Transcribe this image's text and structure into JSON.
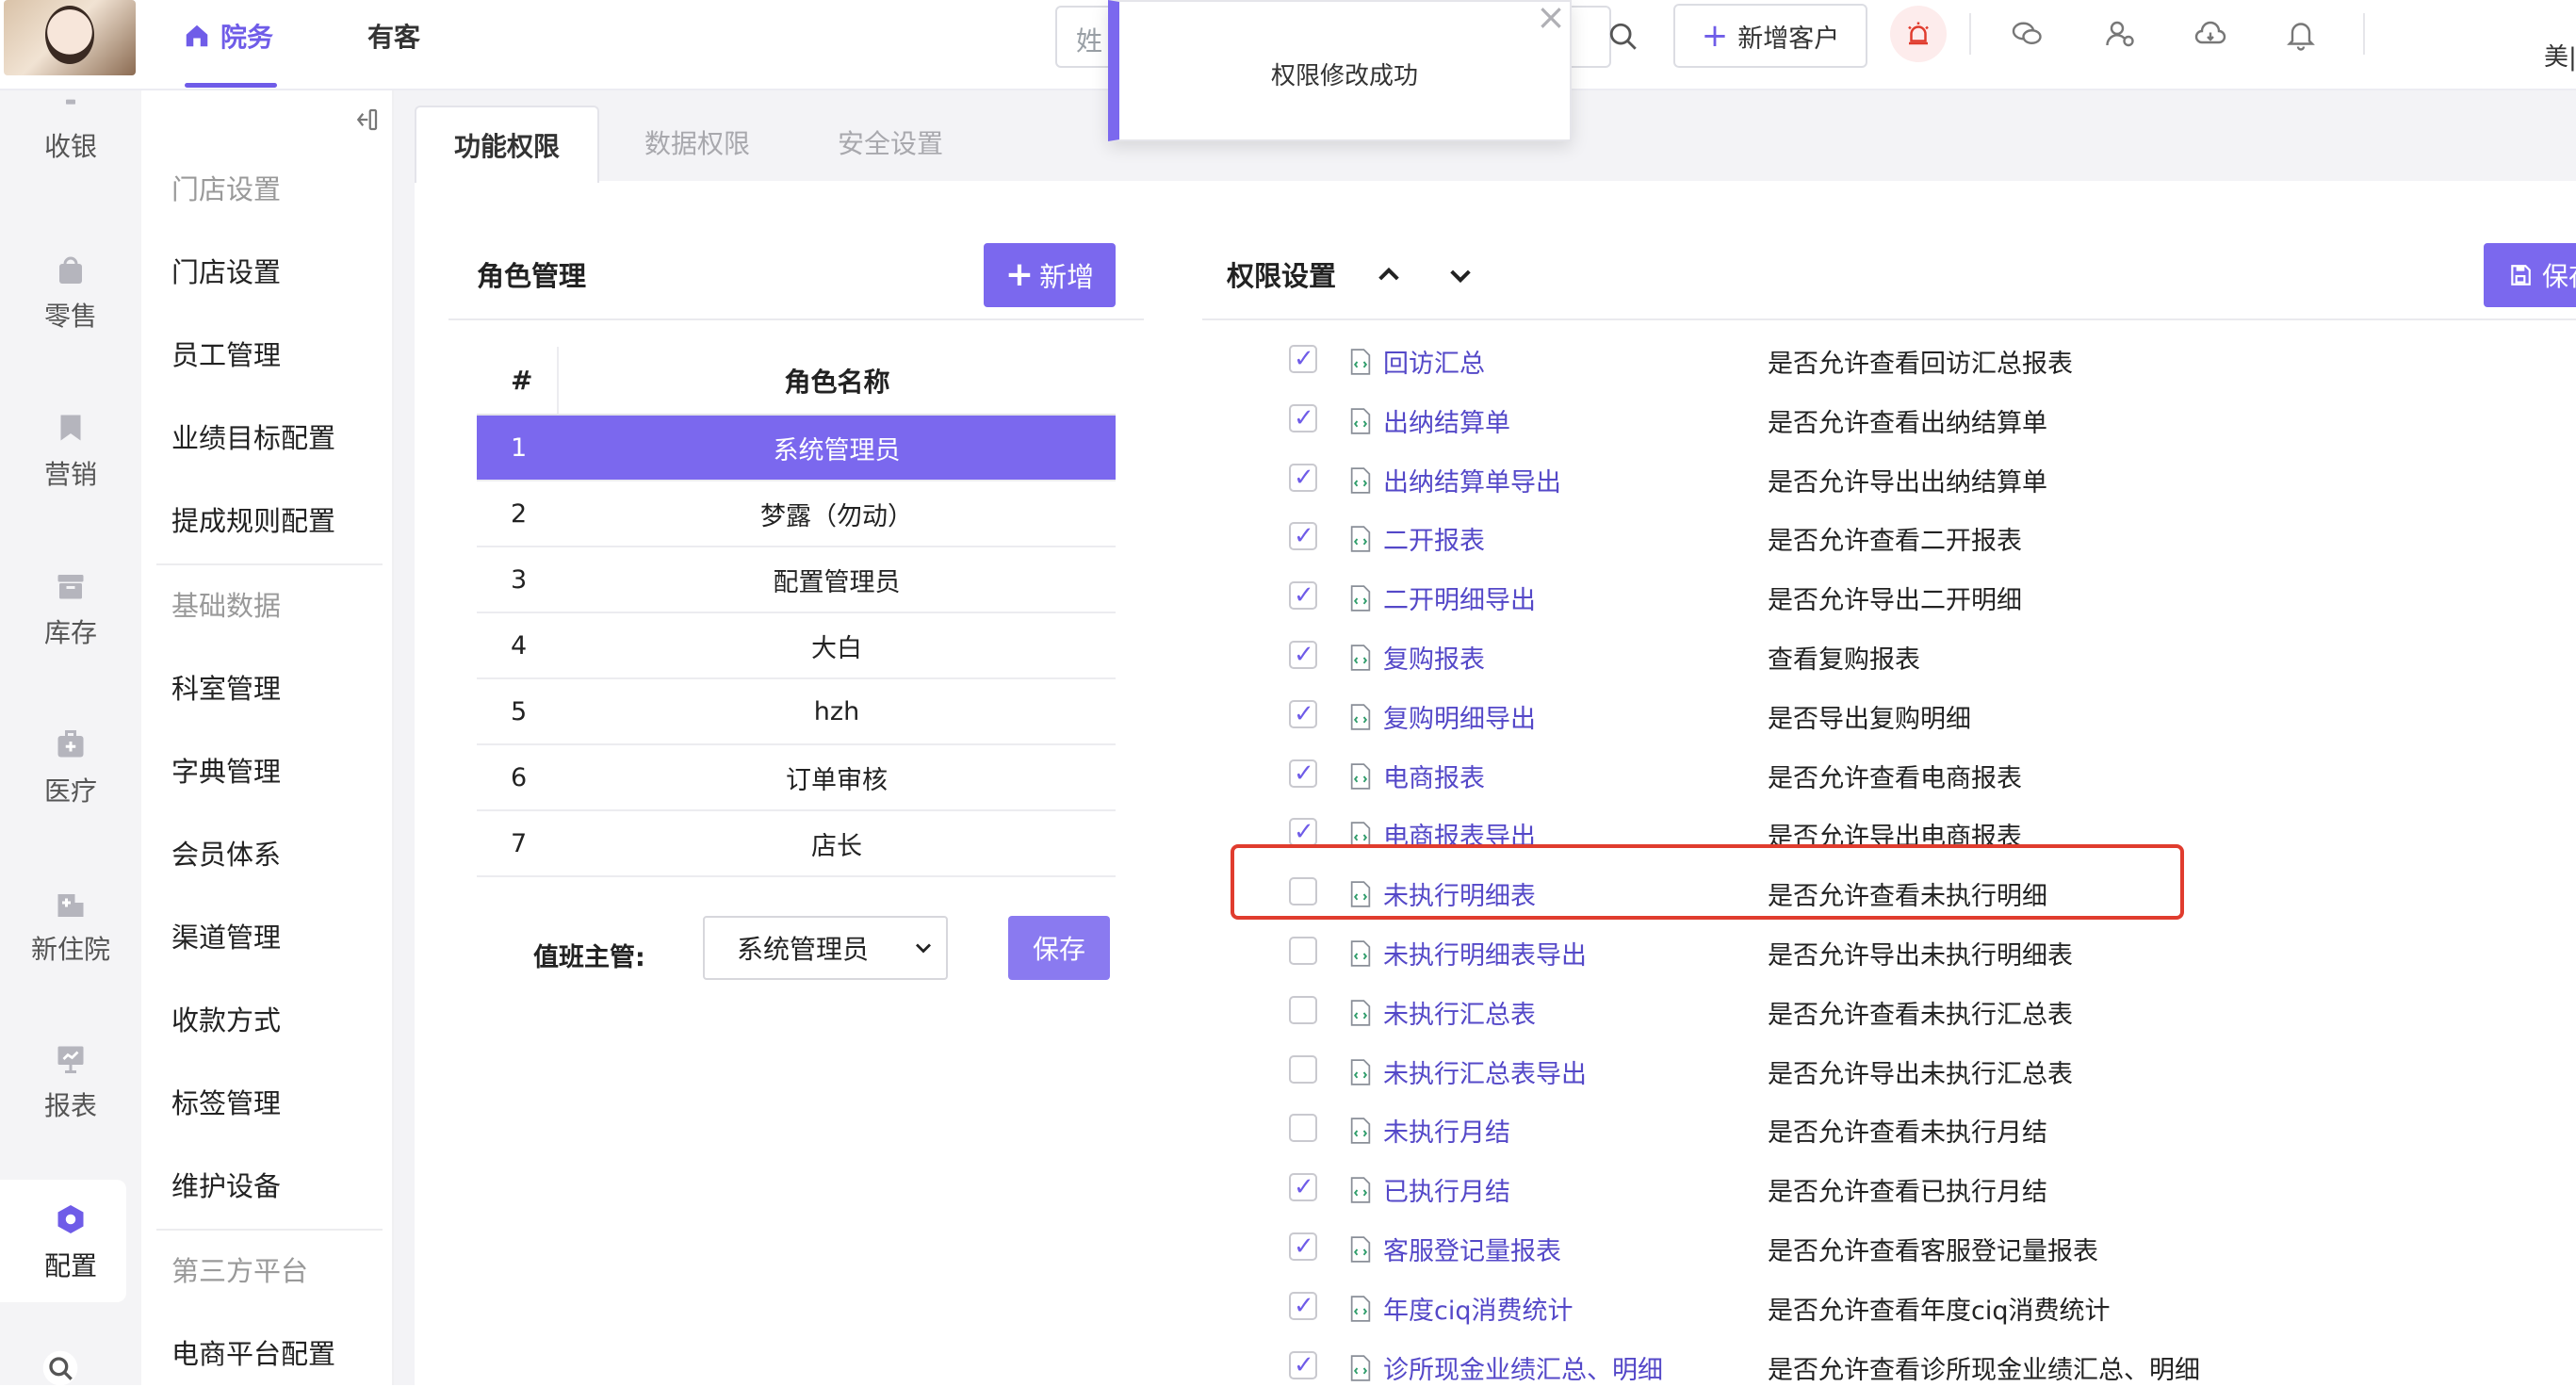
{
  "topbar": {
    "nav": [
      {
        "label": "院务",
        "active": true,
        "icon": "home-icon"
      },
      {
        "label": "有客",
        "active": false
      }
    ],
    "search_placeholder": "姓",
    "add_customer_label": "新增客户",
    "user_label": "美|",
    "icons": [
      "alarm-icon",
      "wechat-icon",
      "user-settings-icon",
      "cloud-icon",
      "bell-icon"
    ]
  },
  "toast": {
    "message": "权限修改成功"
  },
  "rail": {
    "items": [
      {
        "label": "收银",
        "icon": "cashier-icon"
      },
      {
        "label": "零售",
        "icon": "bag-icon"
      },
      {
        "label": "营销",
        "icon": "bookmark-icon"
      },
      {
        "label": "库存",
        "icon": "box-icon"
      },
      {
        "label": "医疗",
        "icon": "medical-kit-icon"
      },
      {
        "label": "新住院",
        "icon": "hospital-icon"
      },
      {
        "label": "报表",
        "icon": "report-board-icon"
      },
      {
        "label": "配置",
        "icon": "config-hex-icon",
        "active": true
      }
    ]
  },
  "submenu": {
    "items": [
      {
        "label": "门店设置",
        "type": "group"
      },
      {
        "label": "门店设置",
        "type": "item"
      },
      {
        "label": "员工管理",
        "type": "item"
      },
      {
        "label": "业绩目标配置",
        "type": "item"
      },
      {
        "label": "提成规则配置",
        "type": "item"
      },
      {
        "label": "基础数据",
        "type": "group"
      },
      {
        "label": "科室管理",
        "type": "item"
      },
      {
        "label": "字典管理",
        "type": "item"
      },
      {
        "label": "会员体系",
        "type": "item"
      },
      {
        "label": "渠道管理",
        "type": "item"
      },
      {
        "label": "收款方式",
        "type": "item"
      },
      {
        "label": "标签管理",
        "type": "item"
      },
      {
        "label": "维护设备",
        "type": "item"
      },
      {
        "label": "第三方平台",
        "type": "group"
      },
      {
        "label": "电商平台配置",
        "type": "item"
      }
    ]
  },
  "tabs": [
    {
      "label": "功能权限",
      "active": true
    },
    {
      "label": "数据权限",
      "active": false
    },
    {
      "label": "安全设置",
      "active": false
    }
  ],
  "roles": {
    "title": "角色管理",
    "add_label": "新增",
    "columns": [
      "#",
      "角色名称"
    ],
    "rows": [
      {
        "no": "1",
        "name": "系统管理员",
        "selected": true
      },
      {
        "no": "2",
        "name": "梦露（勿动）"
      },
      {
        "no": "3",
        "name": "配置管理员"
      },
      {
        "no": "4",
        "name": "大白"
      },
      {
        "no": "5",
        "name": "hzh"
      },
      {
        "no": "6",
        "name": "订单审核"
      },
      {
        "no": "7",
        "name": "店长"
      }
    ],
    "duty_label": "值班主管:",
    "duty_value": "系统管理员",
    "save_label": "保存"
  },
  "permissions": {
    "title": "权限设置",
    "save_label": "保存",
    "rows": [
      {
        "name": "回访汇总",
        "desc": "是否允许查看回访汇总报表",
        "checked": true
      },
      {
        "name": "出纳结算单",
        "desc": "是否允许查看出纳结算单",
        "checked": true
      },
      {
        "name": "出纳结算单导出",
        "desc": "是否允许导出出纳结算单",
        "checked": true
      },
      {
        "name": "二开报表",
        "desc": "是否允许查看二开报表",
        "checked": true
      },
      {
        "name": "二开明细导出",
        "desc": "是否允许导出二开明细",
        "checked": true
      },
      {
        "name": "复购报表",
        "desc": "查看复购报表",
        "checked": true
      },
      {
        "name": "复购明细导出",
        "desc": "是否导出复购明细",
        "checked": true
      },
      {
        "name": "电商报表",
        "desc": "是否允许查看电商报表",
        "checked": true
      },
      {
        "name": "电商报表导出",
        "desc": "是否允许导出电商报表",
        "checked": true
      },
      {
        "name": "未执行明细表",
        "desc": "是否允许查看未执行明细",
        "checked": false,
        "highlighted": true
      },
      {
        "name": "未执行明细表导出",
        "desc": "是否允许导出未执行明细表",
        "checked": false
      },
      {
        "name": "未执行汇总表",
        "desc": "是否允许查看未执行汇总表",
        "checked": false
      },
      {
        "name": "未执行汇总表导出",
        "desc": "是否允许导出未执行汇总表",
        "checked": false
      },
      {
        "name": "未执行月结",
        "desc": "是否允许查看未执行月结",
        "checked": false
      },
      {
        "name": "已执行月结",
        "desc": "是否允许查看已执行月结",
        "checked": true
      },
      {
        "name": "客服登记量报表",
        "desc": "是否允许查看客服登记量报表",
        "checked": true
      },
      {
        "name": "年度ciq消费统计",
        "desc": "是否允许查看年度ciq消费统计",
        "checked": true
      },
      {
        "name": "诊所现金业绩汇总、明细",
        "desc": "是否允许查看诊所现金业绩汇总、明细",
        "checked": true
      }
    ]
  },
  "colors": {
    "accent": "#7b68ee",
    "highlight": "#e03c2e",
    "link": "#5448c8"
  }
}
